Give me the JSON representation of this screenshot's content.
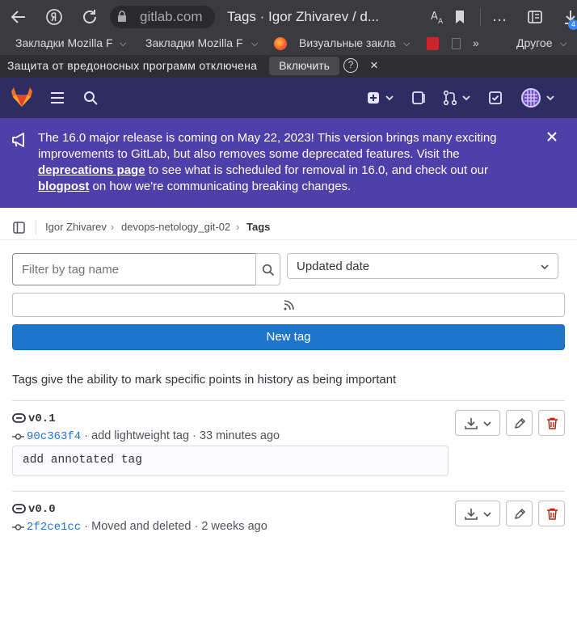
{
  "browser": {
    "host": "gitlab.com",
    "tab_title": "Tags · Igor Zhivarev / d...",
    "tab_badge": "4",
    "bookmarks": [
      "Закладки Mozilla F",
      "Закладки Mozilla F",
      "Визуальные закла",
      "Другое"
    ],
    "warning_text": "Защита от вредоносных программ отключена",
    "warning_button": "Включить",
    "warning_help": "?",
    "warning_close": "×"
  },
  "banner": {
    "part1": "The 16.0 major release is coming on May 22, 2023! This version brings many exciting improvements to GitLab, but also removes some deprecated features. Visit the ",
    "link1": "deprecations page",
    "part2": " to see what is scheduled for removal in 16.0, and check out our ",
    "link2": "blogpost",
    "part3": " on how we're communicating breaking changes."
  },
  "breadcrumb": {
    "items": [
      "Igor Zhivarev",
      "devops-netology_git-02",
      "Tags"
    ]
  },
  "filter": {
    "placeholder": "Filter by tag name",
    "sort_value": "Updated date"
  },
  "new_tag_label": "New tag",
  "description": "Tags give the ability to mark specific points in history as being important",
  "tags": [
    {
      "name": "v0.1",
      "sha": "90c363f4",
      "commit_msg": "add lightweight tag",
      "time": "33 minutes ago",
      "message": "add annotated tag"
    },
    {
      "name": "v0.0",
      "sha": "2f2ce1cc",
      "commit_msg": "Moved and deleted",
      "time": "2 weeks ago"
    }
  ],
  "colors": {
    "nav": "#2d2c63",
    "banner": "#4f3fa8",
    "primary": "#1f75cb"
  }
}
